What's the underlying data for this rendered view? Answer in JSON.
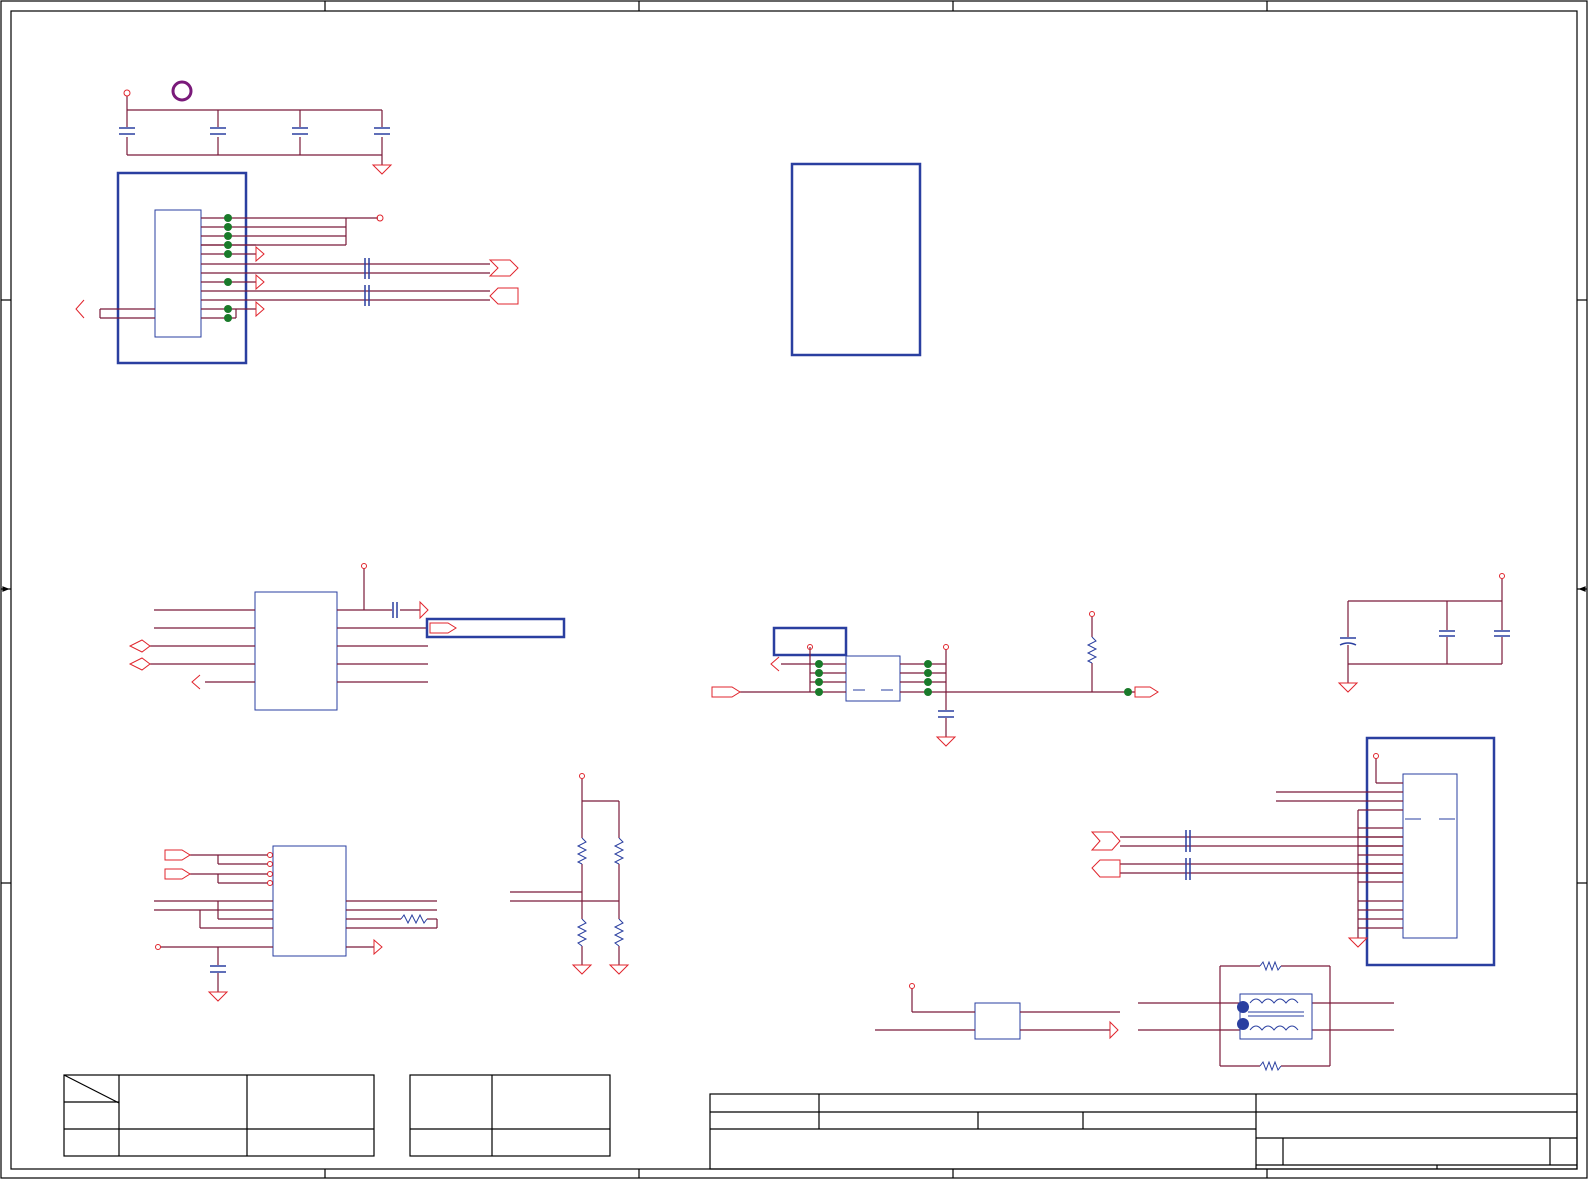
{
  "colors": {
    "wire": "#7a1a3a",
    "pin": "#e0242c",
    "component": "#2a3fa0",
    "junction": "#1a7a2a",
    "frame": "#000000",
    "marker": "#7a1a7a"
  },
  "sheet": {
    "has_border": true,
    "column_zones": 5,
    "row_zones": 4,
    "text_labels": []
  }
}
